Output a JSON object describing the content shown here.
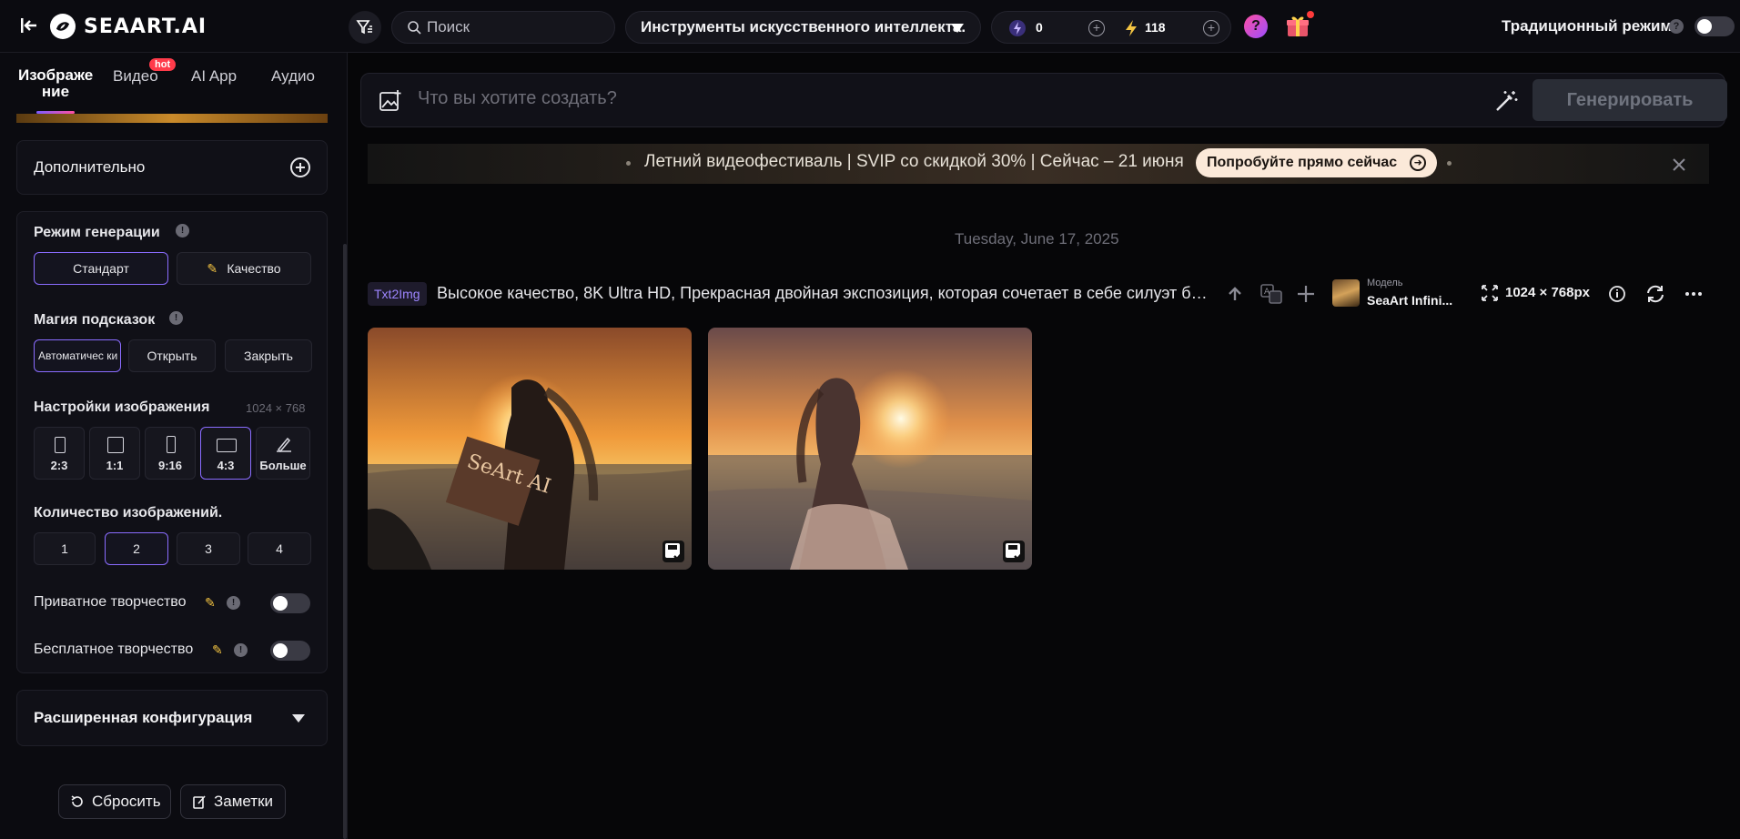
{
  "header": {
    "logo_text": "SEAART.AI",
    "search_placeholder": "Поиск",
    "tools_label": "Инструменты искусственного интеллекта.",
    "credits_energy": "0",
    "credits_bolt": "118",
    "help_label": "?",
    "mode_label": "Традиционный режим",
    "mode_help": "?"
  },
  "sidebar": {
    "tabs": [
      {
        "label": "Изображе ние",
        "active": true
      },
      {
        "label": "Видео",
        "active": false
      },
      {
        "label": "AI App",
        "active": false
      },
      {
        "label": "Аудио",
        "active": false
      }
    ],
    "hot_badge": "hot",
    "additional_label": "Дополнительно",
    "gen_mode": {
      "label": "Режим генерации",
      "options": [
        "Стандарт",
        "Качество"
      ],
      "selected": "Стандарт"
    },
    "prompt_magic": {
      "label": "Магия подсказок",
      "options": [
        "Автоматичес ки",
        "Открыть",
        "Закрыть"
      ],
      "selected": "Автоматичес ки"
    },
    "image_settings": {
      "label": "Настройки изображения",
      "resolution": "1024 × 768",
      "ratios": [
        "2:3",
        "1:1",
        "9:16",
        "4:3",
        "Больше"
      ],
      "selected": "4:3"
    },
    "image_count": {
      "label": "Количество изображений.",
      "options": [
        "1",
        "2",
        "3",
        "4"
      ],
      "selected": "2"
    },
    "private_label": "Приватное творчество",
    "free_label": "Бесплатное творчество",
    "advanced_label": "Расширенная конфигурация",
    "reset_label": "Сбросить",
    "notes_label": "Заметки"
  },
  "main": {
    "prompt_placeholder": "Что вы хотите создать?",
    "generate_label": "Генерировать",
    "promo_text": "Летний видеофестиваль | SVIP со скидкой 30% | Сейчас – 21 июня",
    "promo_button": "Попробуйте прямо сейчас",
    "date": "Tuesday, June 17, 2025",
    "task": {
      "tag": "Txt2Img",
      "prompt": "Высокое качество, 8K Ultra HD, Прекрасная двойная экспозиция, которая сочетает в себе силуэт богини с закатом на побережье",
      "model_label": "Модель",
      "model_name": "SeaArt Infini...",
      "size": "1024 × 768px"
    },
    "image1_sign_text": "SeArt AI"
  },
  "colors": {
    "accent": "#8a6cff",
    "hot": "#ff3b4a",
    "vip": "#f5c542"
  }
}
